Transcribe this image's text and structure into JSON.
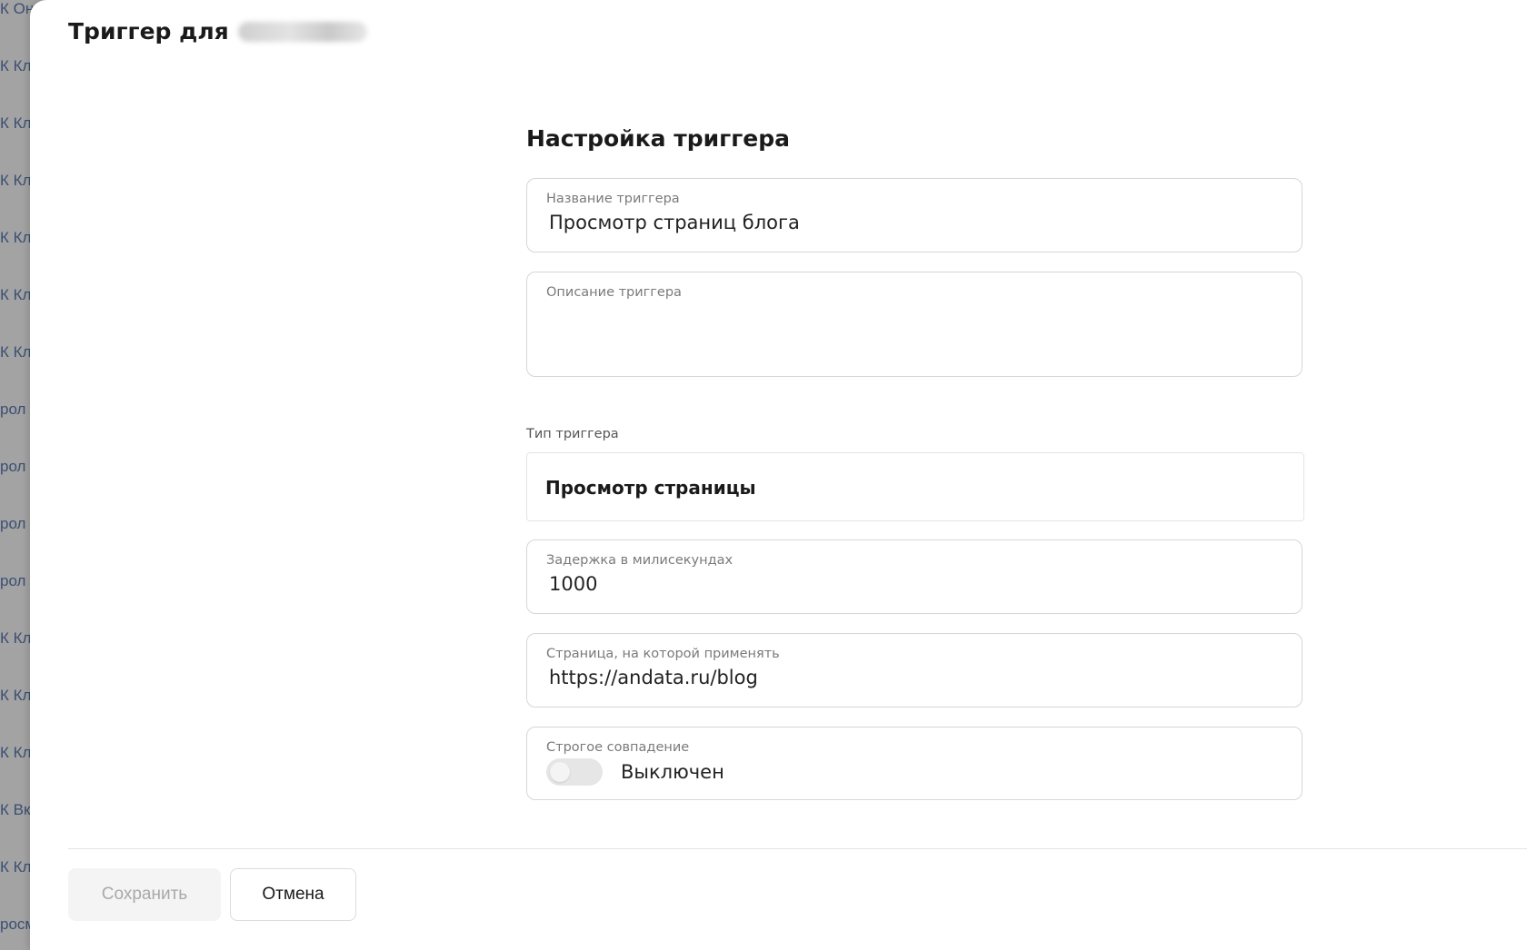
{
  "background": {
    "items": [
      "К Онб",
      "К Кл",
      "К Кл",
      "К Кл",
      "К Кл",
      "К Кл",
      "К Кл",
      "рол",
      "рол",
      "рол",
      "рол",
      "К Кл",
      "К Кл",
      "К Кл",
      "К Вк",
      "К Кл",
      "росм"
    ]
  },
  "drawer": {
    "title": "Триггер для"
  },
  "form": {
    "section_title": "Настройка триггера",
    "name": {
      "label": "Название триггера",
      "value": "Просмотр страниц блога"
    },
    "description": {
      "label": "Описание триггера",
      "value": ""
    },
    "type": {
      "label": "Тип триггера",
      "value": "Просмотр страницы"
    },
    "delay": {
      "label": "Задержка в милисекундах",
      "value": "1000"
    },
    "page": {
      "label": "Страница, на которой применять",
      "value": "https://andata.ru/blog"
    },
    "strict": {
      "label": "Строгое совпадение",
      "state_text": "Выключен",
      "enabled": false
    }
  },
  "footer": {
    "save_label": "Сохранить",
    "cancel_label": "Отмена"
  },
  "colors": {
    "overlay": "#9c9c9c",
    "background_link": "#3b4f73",
    "field_border": "#d6d6d6",
    "disabled_text": "#a9a9a9"
  }
}
